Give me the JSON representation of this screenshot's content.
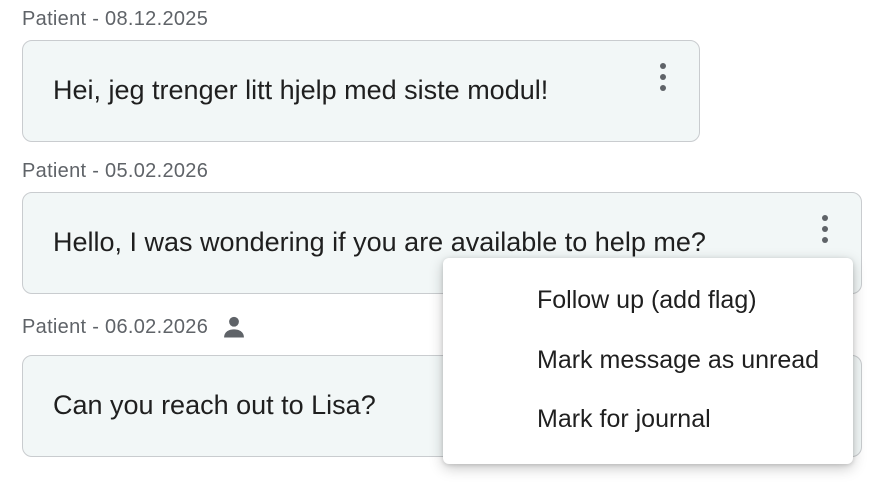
{
  "messages": [
    {
      "meta": "Patient - 08.12.2025",
      "text": "Hei, jeg trenger litt hjelp med siste modul!"
    },
    {
      "meta": "Patient - 05.02.2026",
      "text": "Hello, I was wondering if you are available to help me?"
    },
    {
      "meta": "Patient - 06.02.2026",
      "text": "Can you reach out to Lisa?",
      "icon": "person-icon"
    }
  ],
  "context_menu": {
    "items": [
      {
        "label": "Follow up (add flag)"
      },
      {
        "label": "Mark message as unread"
      },
      {
        "label": "Mark for journal"
      }
    ]
  },
  "colors": {
    "bubble_bg": "#f2f7f7",
    "bubble_border": "#c9cccf",
    "meta_text": "#5f6368",
    "icon": "#5f6368"
  }
}
